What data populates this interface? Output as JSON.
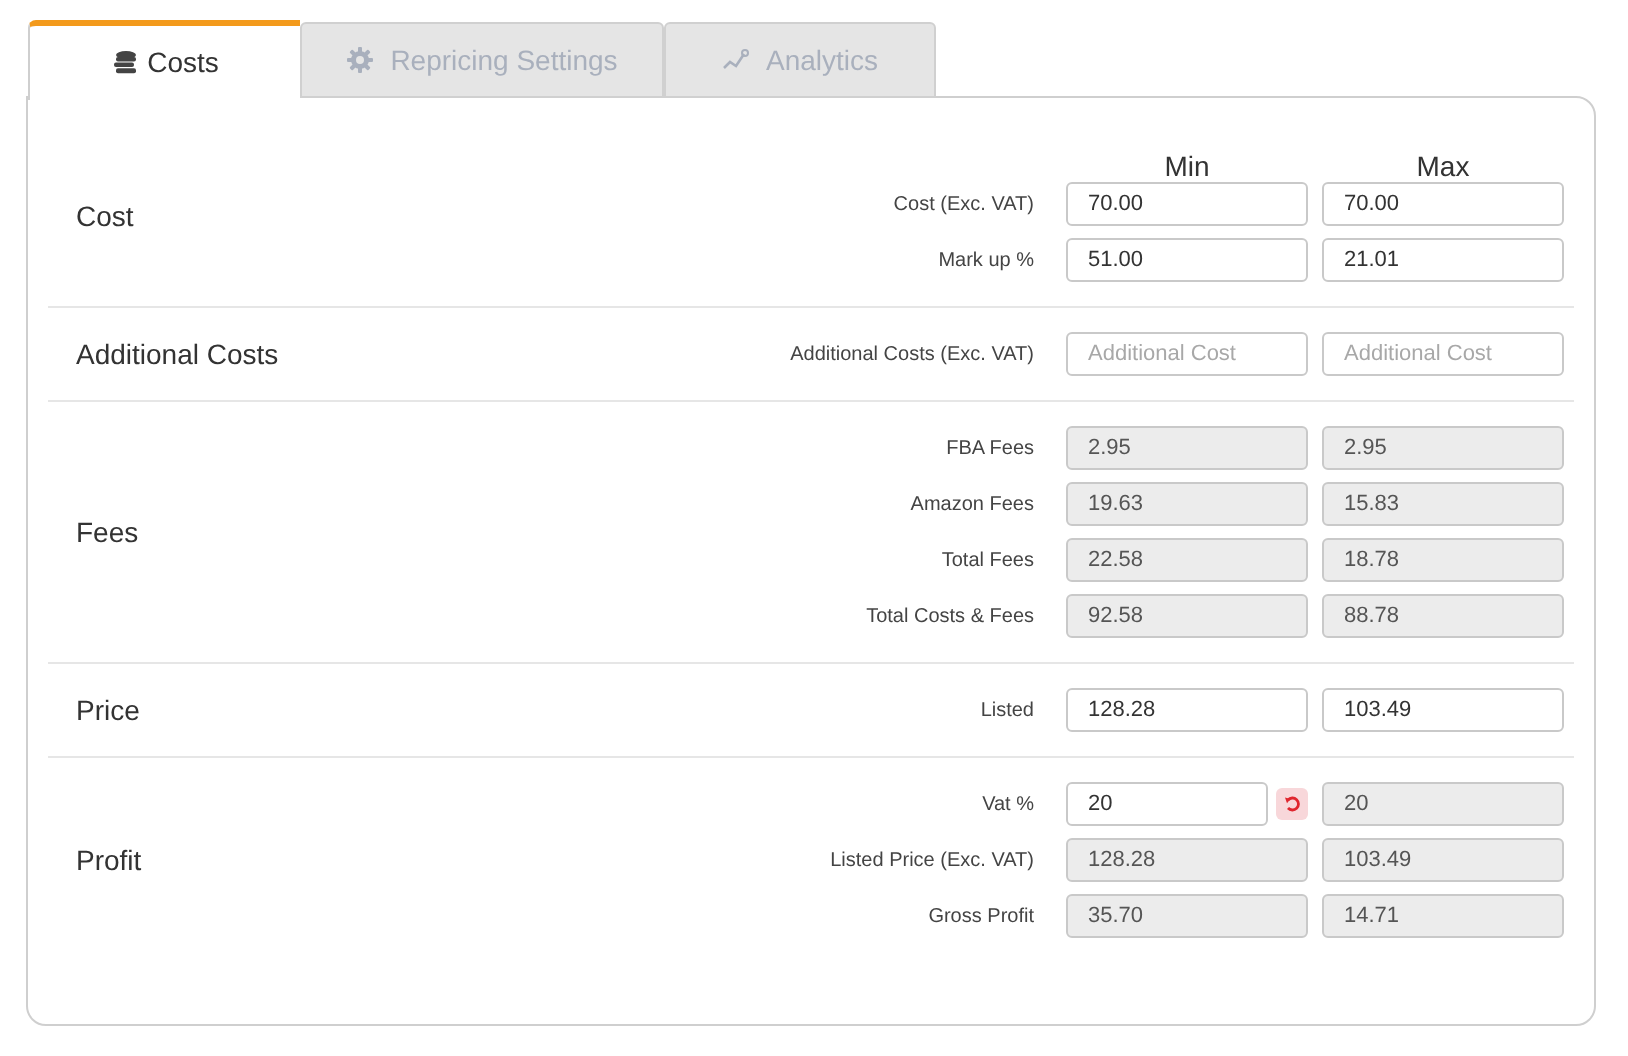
{
  "tabs": [
    {
      "label": "Costs",
      "selected": true
    },
    {
      "label": "Repricing Settings",
      "selected": false
    },
    {
      "label": "Analytics",
      "selected": false
    }
  ],
  "columns": [
    "Min",
    "Max"
  ],
  "sections": [
    {
      "title": "Cost",
      "rows": [
        {
          "label": "Cost (Exc. VAT)",
          "min": {
            "value": "70.00",
            "disabled": false
          },
          "max": {
            "value": "70.00",
            "disabled": false
          }
        },
        {
          "label": "Mark up %",
          "min": {
            "value": "51.00",
            "disabled": false
          },
          "max": {
            "value": "21.01",
            "disabled": false
          }
        }
      ]
    },
    {
      "title": "Additional Costs",
      "rows": [
        {
          "label": "Additional Costs (Exc. VAT)",
          "min": {
            "placeholder": "Additional Cost",
            "disabled": false
          },
          "max": {
            "placeholder": "Additional Cost",
            "disabled": false
          }
        }
      ]
    },
    {
      "title": "Fees",
      "rows": [
        {
          "label": "FBA Fees",
          "min": {
            "value": "2.95",
            "disabled": true
          },
          "max": {
            "value": "2.95",
            "disabled": true
          }
        },
        {
          "label": "Amazon Fees",
          "min": {
            "value": "19.63",
            "disabled": true
          },
          "max": {
            "value": "15.83",
            "disabled": true
          }
        },
        {
          "label": "Total Fees",
          "min": {
            "value": "22.58",
            "disabled": true
          },
          "max": {
            "value": "18.78",
            "disabled": true
          }
        },
        {
          "label": "Total Costs & Fees",
          "min": {
            "value": "92.58",
            "disabled": true
          },
          "max": {
            "value": "88.78",
            "disabled": true
          }
        }
      ]
    },
    {
      "title": "Price",
      "rows": [
        {
          "label": "Listed",
          "min": {
            "value": "128.28",
            "disabled": false
          },
          "max": {
            "value": "103.49",
            "disabled": false
          }
        }
      ]
    },
    {
      "title": "Profit",
      "rows": [
        {
          "label": "Vat %",
          "min": {
            "value": "20",
            "disabled": false,
            "reset": true
          },
          "max": {
            "value": "20",
            "disabled": true
          }
        },
        {
          "label": "Listed Price (Exc. VAT)",
          "min": {
            "value": "128.28",
            "disabled": true
          },
          "max": {
            "value": "103.49",
            "disabled": true
          }
        },
        {
          "label": "Gross Profit",
          "min": {
            "value": "35.70",
            "disabled": true
          },
          "max": {
            "value": "14.71",
            "disabled": true
          }
        }
      ]
    }
  ]
}
